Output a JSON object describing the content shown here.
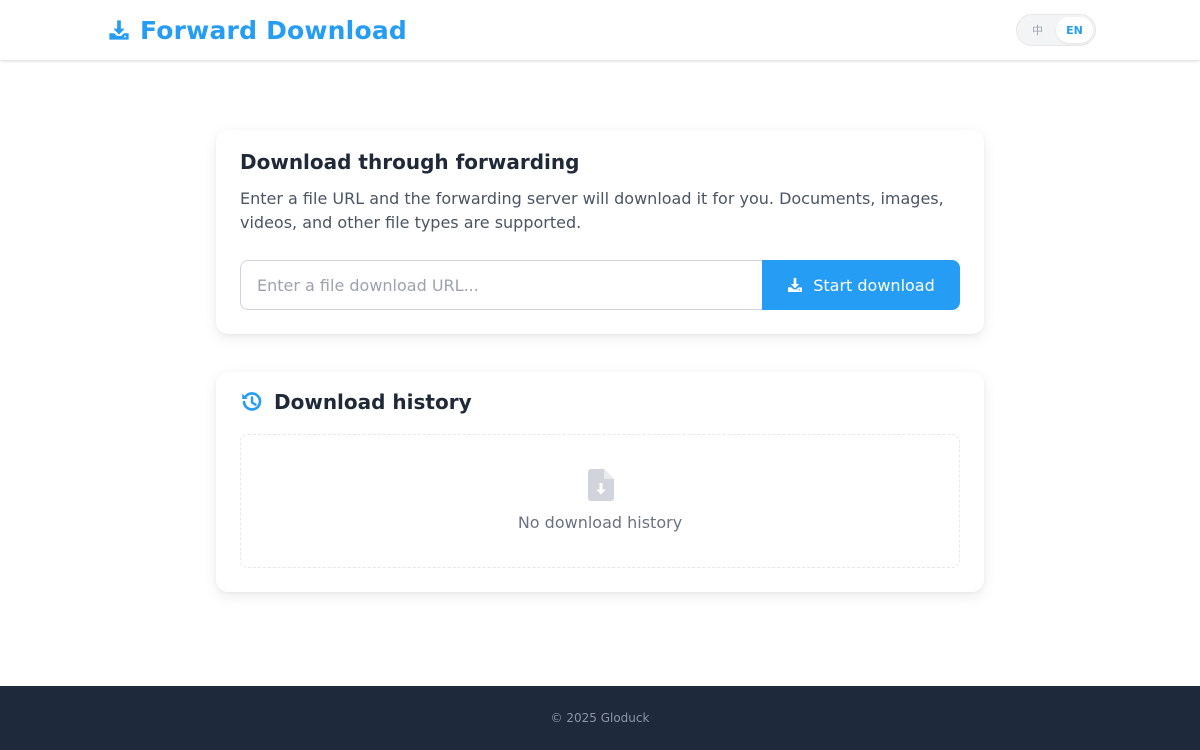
{
  "header": {
    "brand_icon": "download-tray-icon",
    "title": "Forward Download",
    "language": {
      "options": [
        {
          "label": "中",
          "active": false
        },
        {
          "label": "EN",
          "active": true
        }
      ]
    }
  },
  "download_card": {
    "title": "Download through forwarding",
    "description": "Enter a file URL and the forwarding server will download it for you. Documents, images, videos, and other file types are supported.",
    "input": {
      "placeholder": "Enter a file download URL...",
      "value": ""
    },
    "button": {
      "label": "Start download",
      "icon": "download-tray-icon"
    }
  },
  "history_card": {
    "icon": "history-icon",
    "title": "Download history",
    "empty": {
      "icon": "file-download-icon",
      "text": "No download history"
    }
  },
  "footer": {
    "text": "© 2025 Gloduck"
  },
  "colors": {
    "accent": "#259df4",
    "footer_bg": "#1e293b",
    "text_dark": "#1f2937",
    "text_muted": "#6b7280"
  }
}
